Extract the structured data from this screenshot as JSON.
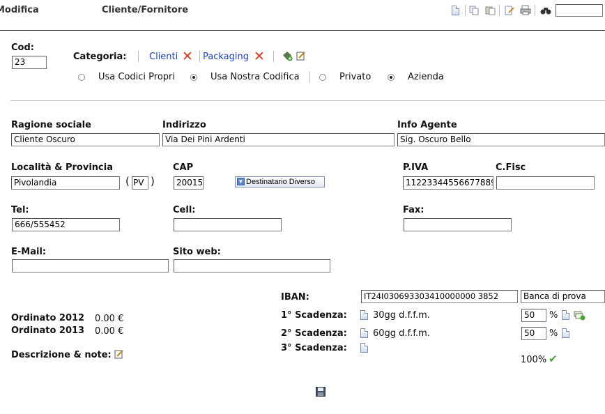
{
  "header": {
    "mode": "Modifica",
    "section": "Cliente/Fornitore",
    "toolbar_icons": [
      "new-document-icon",
      "copy-icon",
      "paste-icon",
      "edit-icon",
      "print-icon",
      "find-icon"
    ],
    "search_value": ""
  },
  "top": {
    "cod_label": "Cod:",
    "cod_value": "23",
    "categoria_label": "Categoria:",
    "categories": [
      {
        "label": "Clienti"
      },
      {
        "label": "Packaging"
      }
    ],
    "code_options": [
      "Usa Codici Propri",
      "Usa Nostra Codifica"
    ],
    "code_selected": "Usa Nostra Codifica",
    "type_options": [
      "Privato",
      "Azienda"
    ],
    "type_selected": "Azienda"
  },
  "form": {
    "ragione_label": "Ragione sociale",
    "ragione_value": "Cliente Oscuro",
    "indirizzo_label": "Indirizzo",
    "indirizzo_value": "Via Dei Pini Ardenti",
    "agente_label": "Info Agente",
    "agente_value": "Sig. Oscuro Bello",
    "localita_label": "Località & Provincia",
    "localita_value": "Pivolandia",
    "provincia_value": "PV",
    "cap_label": "CAP",
    "cap_value": "20015",
    "destinatario_label": "Destinatario Diverso",
    "piva_label": "P.IVA",
    "piva_value": "11223344556677889",
    "cfisc_label": "C.Fisc",
    "cfisc_value": "",
    "tel_label": "Tel:",
    "tel_value": "666/555452",
    "cell_label": "Cell:",
    "cell_value": "",
    "fax_label": "Fax:",
    "fax_value": "",
    "email_label": "E-Mail:",
    "email_value": "",
    "web_label": "Sito web:",
    "web_value": ""
  },
  "payment": {
    "iban_label": "IBAN:",
    "iban_value": "IT24I030693303410000000 3852",
    "bank_value": "Banca di prova",
    "scadenze": [
      {
        "label": "1° Scadenza:",
        "terms": "30gg d.f.f.m.",
        "percent": "50"
      },
      {
        "label": "2° Scadenza:",
        "terms": "60gg d.f.f.m.",
        "percent": "50"
      },
      {
        "label": "3° Scadenza:",
        "terms": "",
        "percent": ""
      }
    ],
    "percent_sign": "%",
    "total": "100%"
  },
  "orders": [
    {
      "label": "Ordinato 2012",
      "value": "0.00 €"
    },
    {
      "label": "Ordinato 2013",
      "value": "0.00 €"
    }
  ],
  "notes_label": "Descrizione & note:"
}
